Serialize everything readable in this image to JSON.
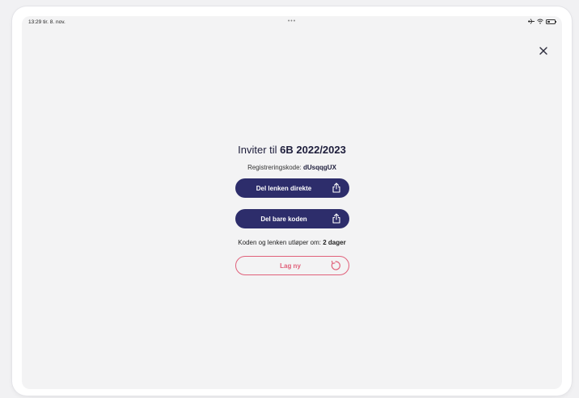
{
  "status_bar": {
    "time": "13:29",
    "date": "tir. 8. nov.",
    "dots": "•••"
  },
  "invite": {
    "title_prefix": "Inviter til",
    "class_name": "6B 2022/2023",
    "code_label": "Registreringskode:",
    "code_value": "dUsqqgUX",
    "share_link_label": "Del lenken direkte",
    "share_code_label": "Del bare koden",
    "expiry_label": "Koden og lenken utløper om:",
    "expiry_value": "2 dager",
    "regenerate_label": "Lag ny"
  },
  "icons": {
    "close": "close-icon",
    "share": "share-icon",
    "refresh": "refresh-icon",
    "airplane": "airplane-icon",
    "wifi": "wifi-icon",
    "battery": "battery-icon"
  },
  "colors": {
    "primary": "#2d2d6b",
    "accent": "#e0607a",
    "background": "#f3f3f4",
    "text": "#1d1d3b"
  }
}
